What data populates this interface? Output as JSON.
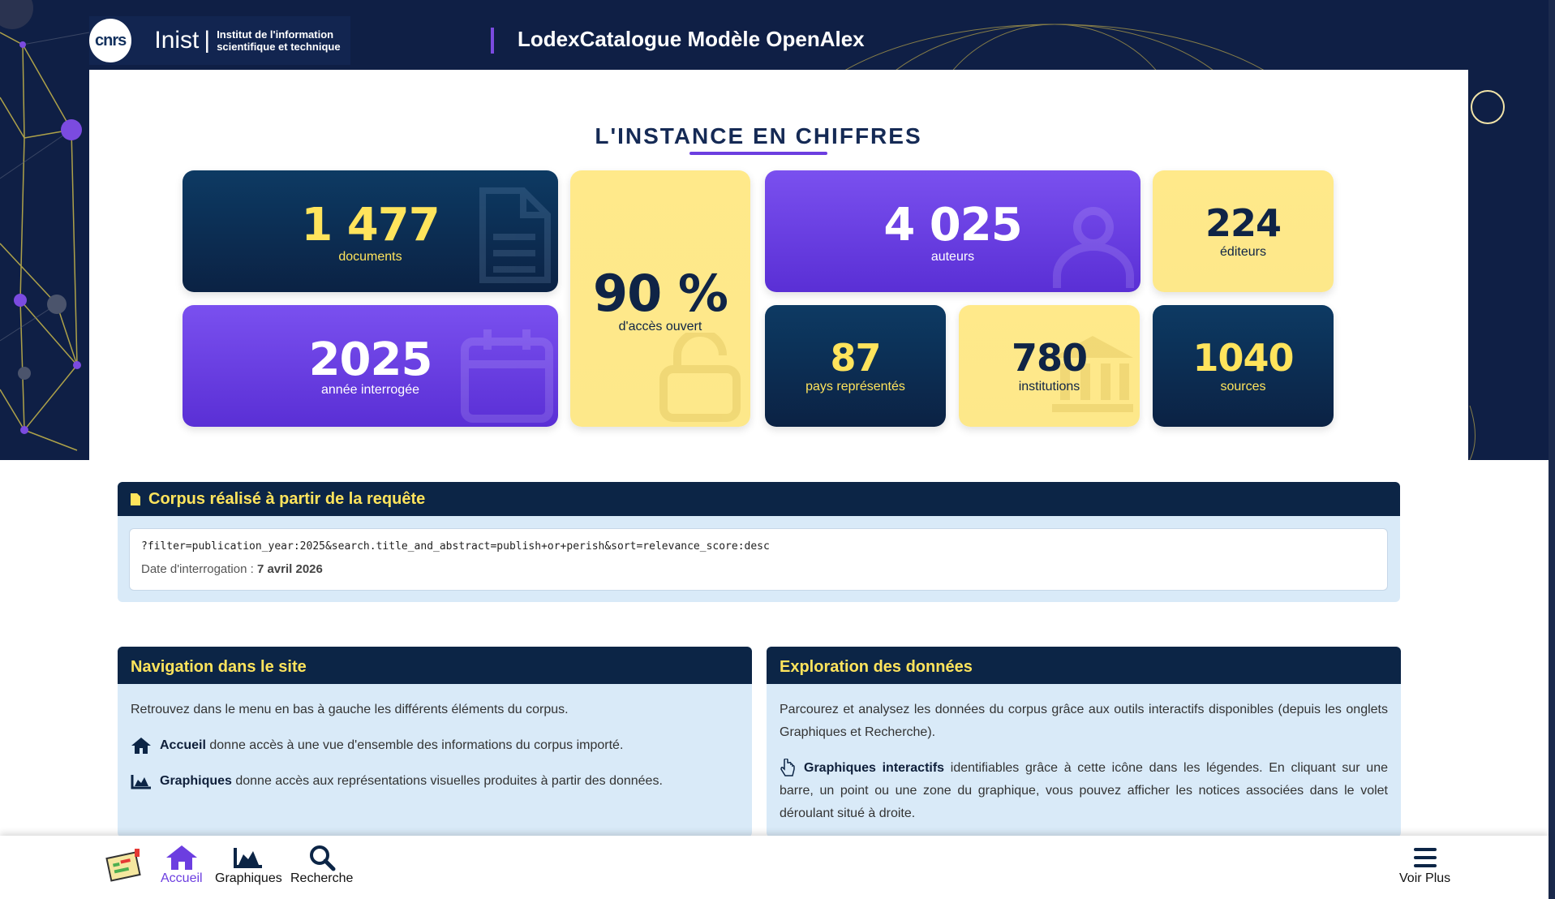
{
  "header": {
    "cnrs_logo": "cnrs",
    "inist": "Inist",
    "inist_sep": "|",
    "inist_subtitle": "Institut de l'information scientifique et technique",
    "site_title": "LodexCatalogue Modèle OpenAlex"
  },
  "stats": {
    "title": "L'INSTANCE EN CHIFFRES",
    "documents": {
      "value": "1 477",
      "label": "documents"
    },
    "open_access": {
      "value": "90 %",
      "label": "d'accès ouvert"
    },
    "authors": {
      "value": "4 025",
      "label": "auteurs"
    },
    "publishers": {
      "value": "224",
      "label": "éditeurs"
    },
    "year": {
      "value": "2025",
      "label": "année interrogée"
    },
    "countries": {
      "value": "87",
      "label": "pays représentés"
    },
    "institutions": {
      "value": "780",
      "label": "institutions"
    },
    "sources": {
      "value": "1040",
      "label": "sources"
    }
  },
  "corpus": {
    "title": "Corpus réalisé à partir de la requête",
    "query": "?filter=publication_year:2025&search.title_and_abstract=publish+or+perish&sort=relevance_score:desc",
    "date_label": "Date d'interrogation : ",
    "date_value": "7 avril 2026"
  },
  "navigation_box": {
    "title": "Navigation dans le site",
    "intro": "Retrouvez dans le menu en bas à gauche les différents éléments du corpus.",
    "accueil_bold": "Accueil",
    "accueil_text": " donne accès à une vue d'ensemble des informations du corpus importé.",
    "graphiques_bold": "Graphiques",
    "graphiques_text": " donne accès aux représentations visuelles produites à partir des données."
  },
  "exploration_box": {
    "title": "Exploration des données",
    "intro": "Parcourez et analysez les données du corpus grâce aux outils interactifs disponibles (depuis les onglets Graphiques et Recherche).",
    "interactive_bold": "Graphiques interactifs",
    "interactive_text": " identifiables grâce à cette icône dans les légendes. En cliquant sur une barre, un point ou une zone du graphique, vous pouvez afficher les notices associées dans le volet déroulant situé à droite."
  },
  "bottom_nav": {
    "accueil": "Accueil",
    "graphiques": "Graphiques",
    "recherche": "Recherche",
    "voir_plus": "Voir Plus"
  },
  "colors": {
    "navy": "#0c2546",
    "purple": "#6c3ee0",
    "yellow": "#ffe45c",
    "light_blue": "#d9eaf8"
  }
}
